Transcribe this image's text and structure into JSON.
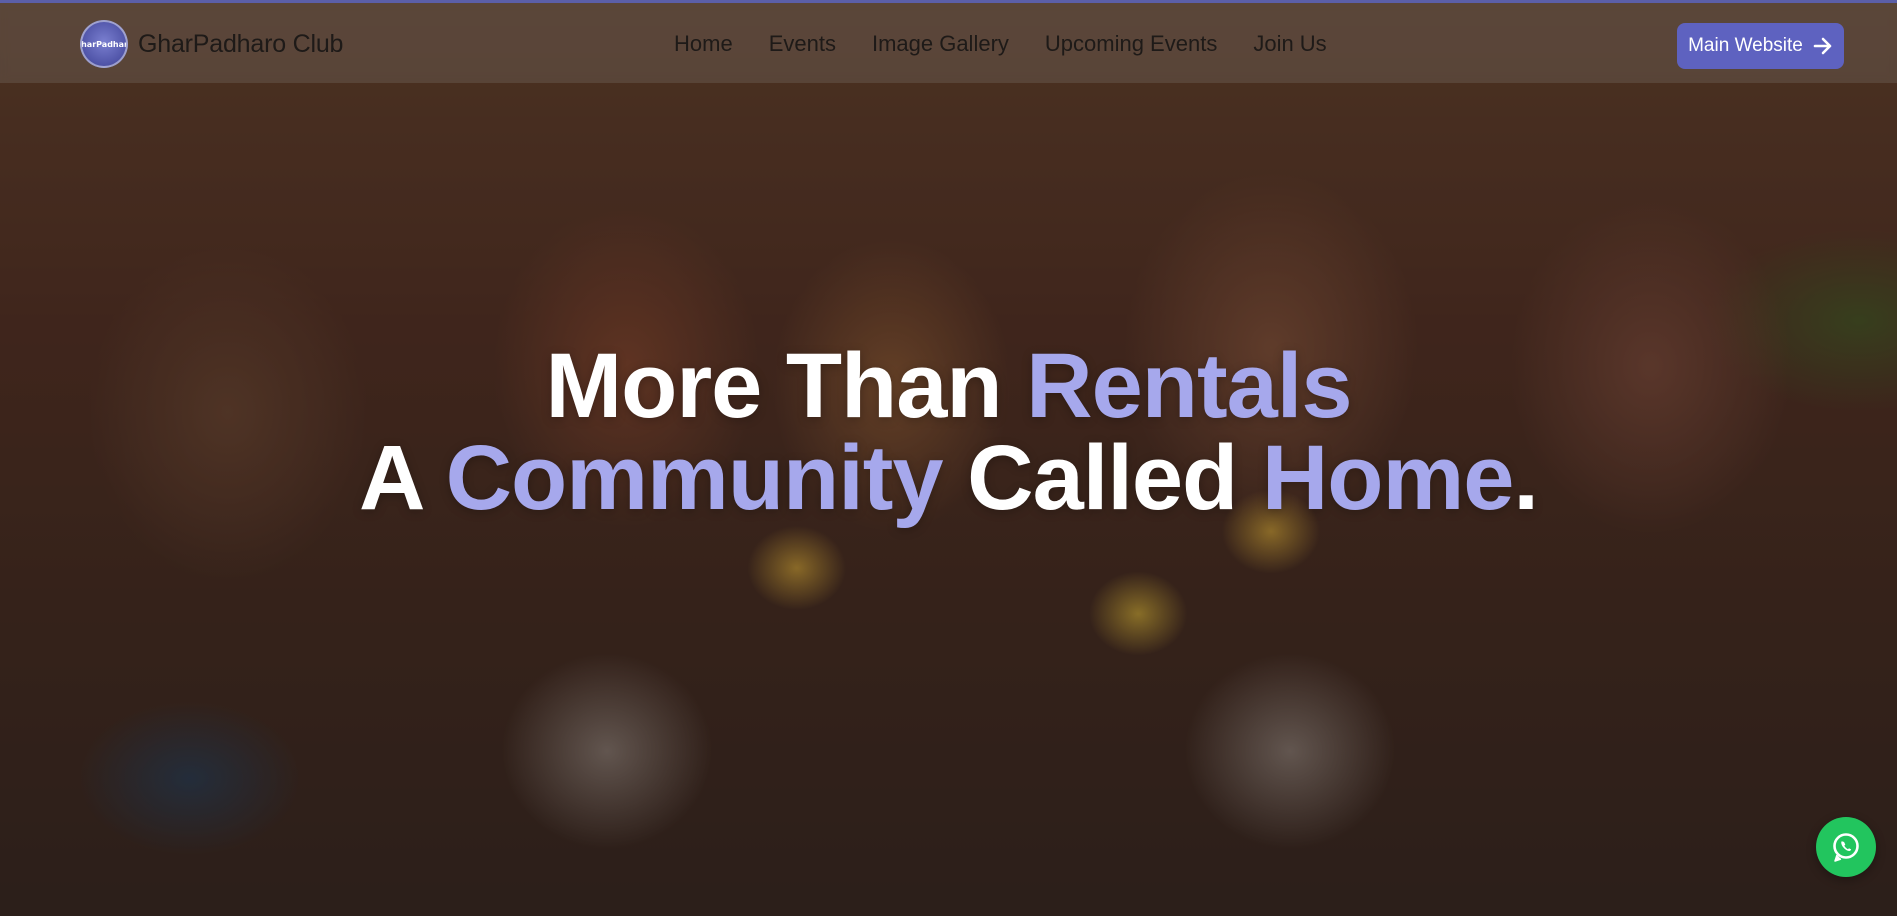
{
  "brand": {
    "name": "GharPadharo Club",
    "logo_text": "GharPadharo"
  },
  "nav": {
    "links": [
      "Home",
      "Events",
      "Image Gallery",
      "Upcoming Events",
      "Join Us"
    ]
  },
  "cta": {
    "label": "Main Website",
    "icon": "arrow-right-icon"
  },
  "hero": {
    "line1_a": "More Than ",
    "line1_b": "Rentals",
    "line2_a": "A ",
    "line2_b": "Community",
    "line2_c": " Called ",
    "line2_d": "Home",
    "line2_e": "."
  },
  "floating": {
    "icon": "whatsapp-icon"
  },
  "colors": {
    "accent": "#a6a8ec",
    "button": "#5e62c0",
    "whatsapp": "#22c55e"
  }
}
